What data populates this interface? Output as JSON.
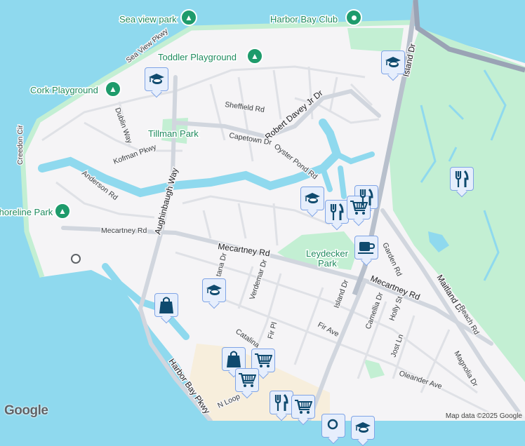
{
  "map": {
    "colors": {
      "water": "#8fd9ee",
      "land": "#f5f4f6",
      "park": "#c3efd3",
      "road": "#d6dae0",
      "highway": "#9aa3b5",
      "marker_icon": "#0f4a6e",
      "pin": "#1e9b6b"
    },
    "places": [
      {
        "name": "Sea view park",
        "icon": "tree-icon"
      },
      {
        "name": "Harbor Bay Club",
        "icon": "dot-icon"
      },
      {
        "name": "Toddler Playground",
        "icon": "tree-icon"
      },
      {
        "name": "Cork Playground",
        "icon": "tree-icon"
      },
      {
        "name": "Shoreline Park",
        "icon": "tree-icon"
      },
      {
        "name": "Tillman Park"
      },
      {
        "name": "Leydecker"
      },
      {
        "name": "Park"
      }
    ],
    "roads": [
      "Sea View Pkwy",
      "Sheffield Rd",
      "Robert Davey Jr Dr",
      "Dublin Way",
      "Capetown Dr",
      "Oyster Pond Rd",
      "Kofman Pkwy",
      "Creedon Cir",
      "Anderson Rd",
      "Aughinbaugh Way",
      "Mecartney Rd",
      "Mecartney Rd",
      "Mecartney Rd",
      "Garden Rd",
      "Island Dr",
      "Island Dr",
      "Verdemar Dr",
      "tana Dr",
      "Fir Pl",
      "Fir Ave",
      "Camellia Dr",
      "Holly St",
      "Maitland Dr",
      "Beach Rd",
      "Jost Ln",
      "Magnolia Dr",
      "Oleander Ave",
      "Catalina",
      "Harbor Bay Pkwy",
      "N Loop"
    ],
    "markers": [
      "school",
      "school",
      "school",
      "school",
      "restaurant",
      "restaurant",
      "restaurant",
      "shopping-cart",
      "coffee",
      "shopping-bag",
      "shopping-bag",
      "shopping-cart",
      "shopping-cart",
      "restaurant",
      "shopping-cart",
      "search",
      "school"
    ],
    "attribution": "Map data ©2025 Google",
    "logo": "Google"
  }
}
